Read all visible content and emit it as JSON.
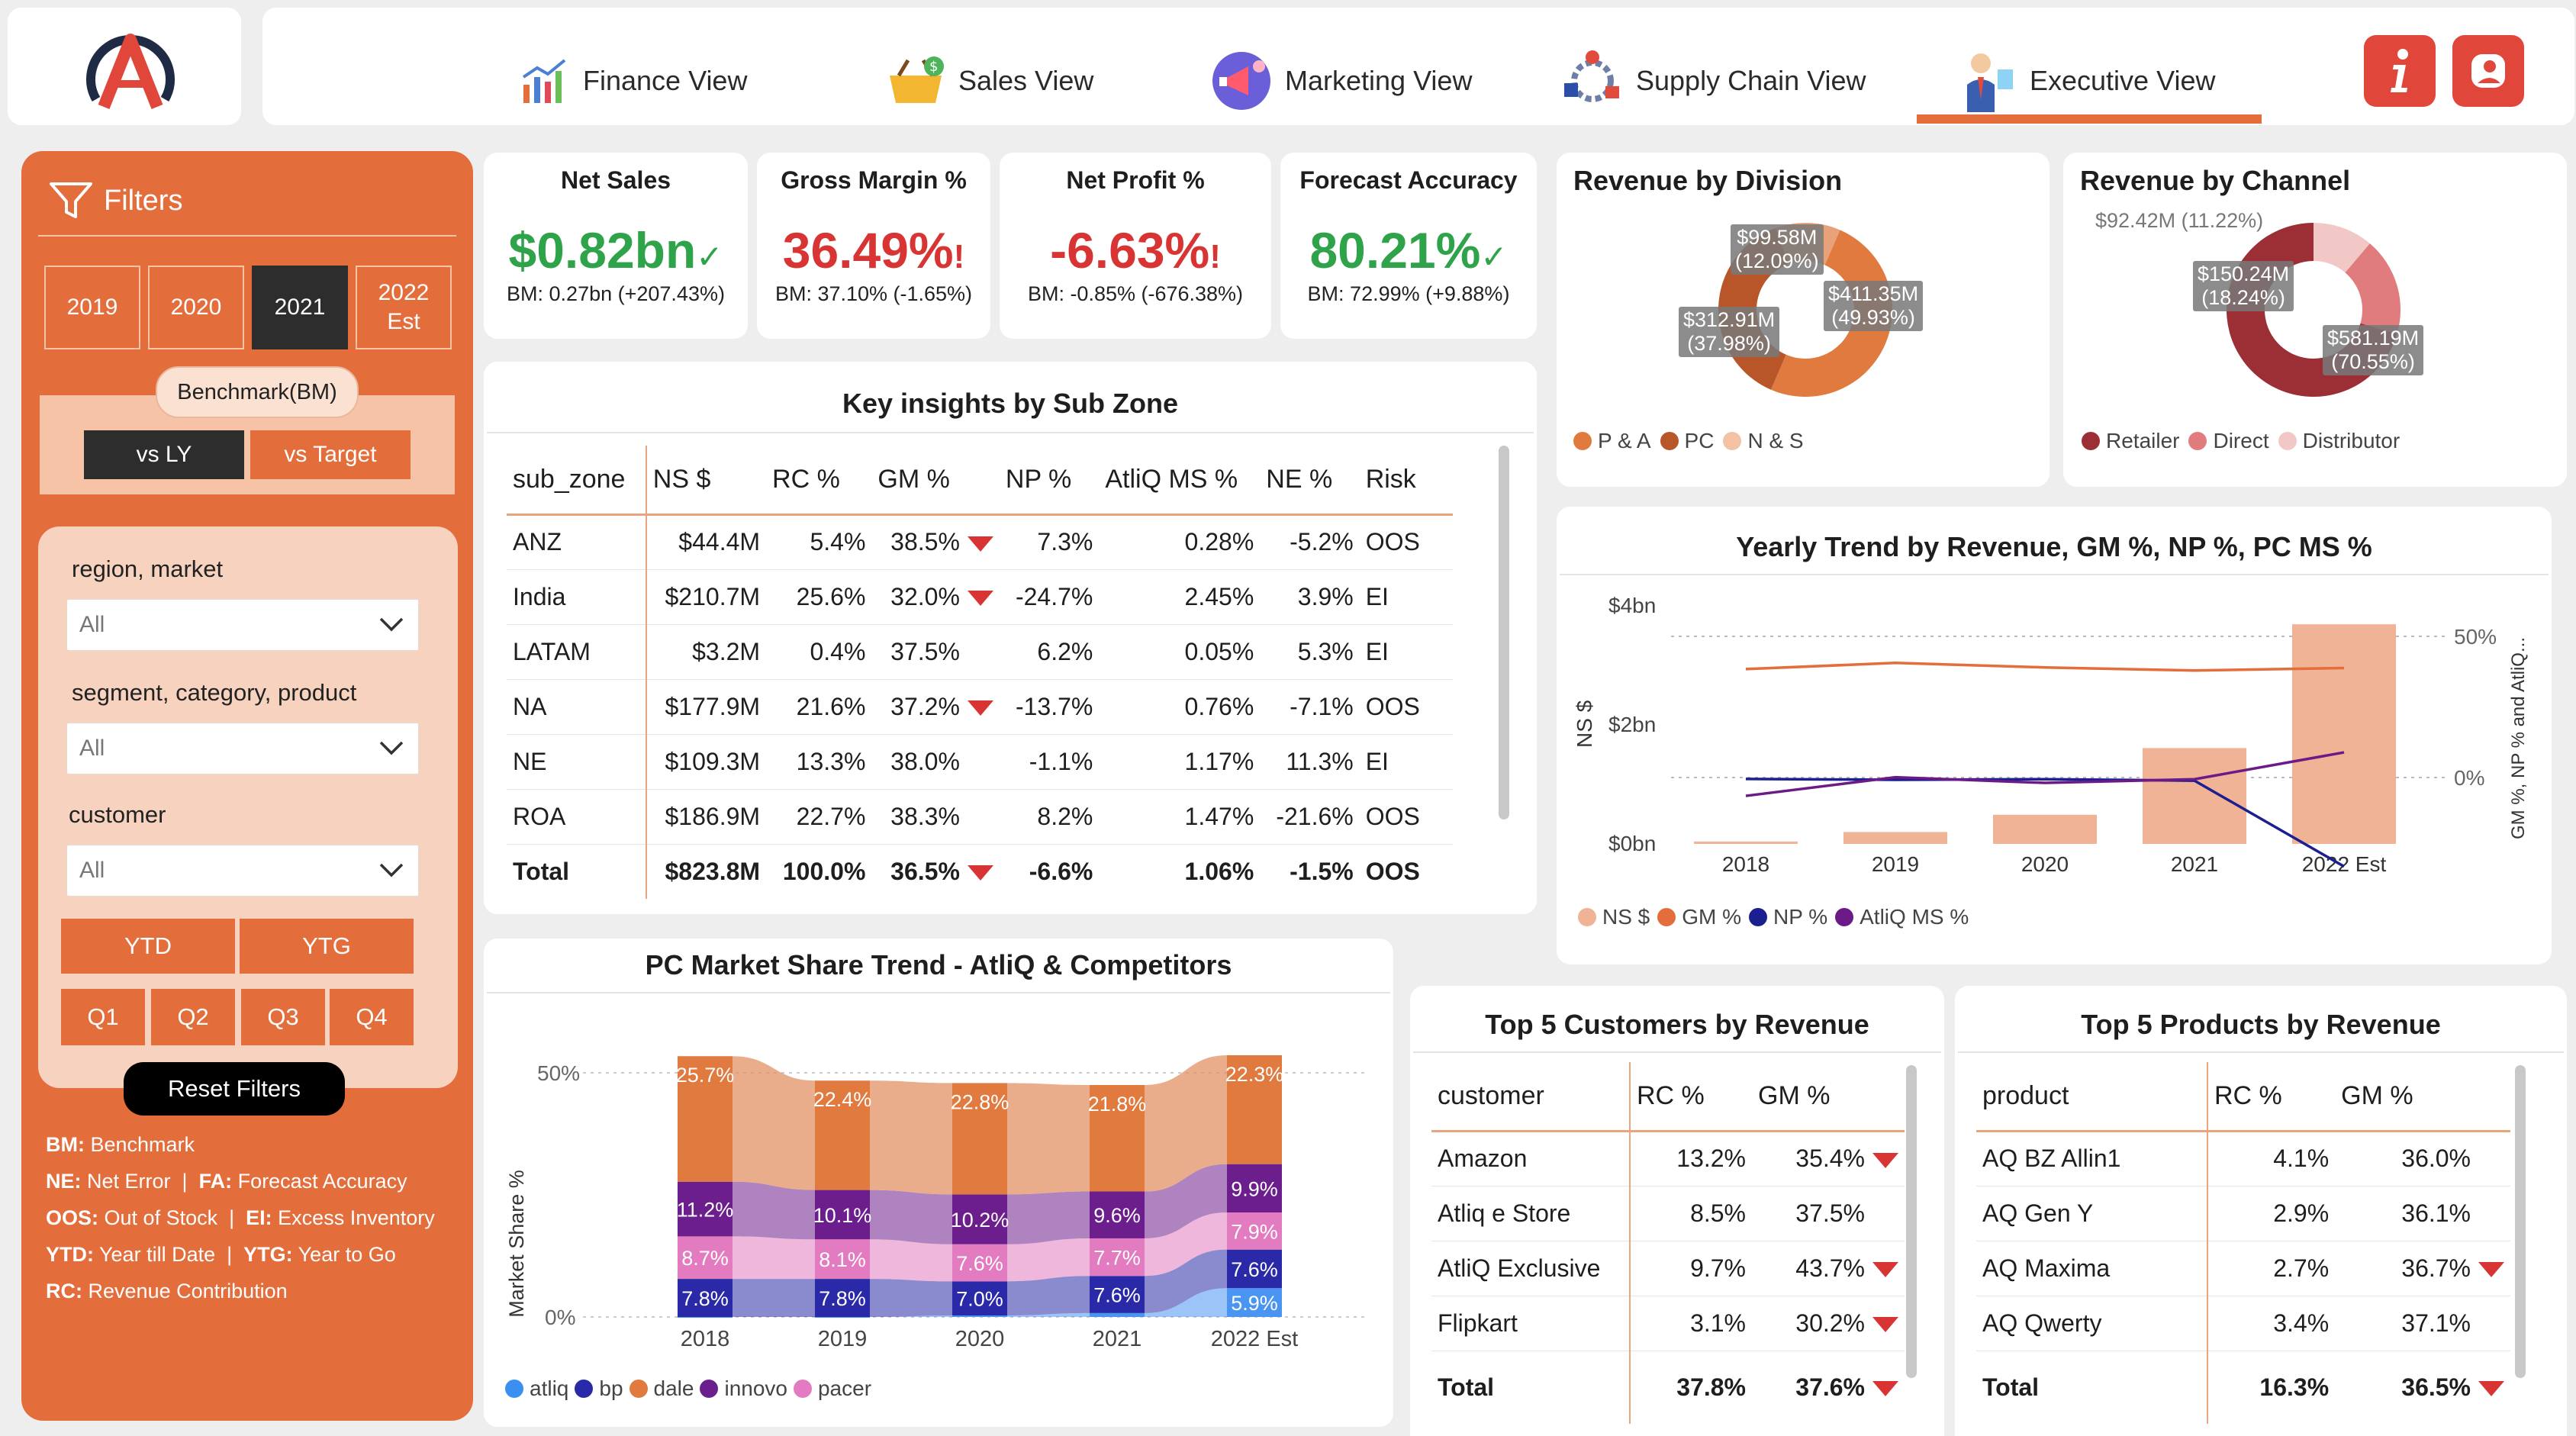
{
  "nav": {
    "tabs": [
      {
        "label": "Finance View",
        "icon": "finance-chart-icon"
      },
      {
        "label": "Sales View",
        "icon": "basket-icon"
      },
      {
        "label": "Marketing View",
        "icon": "megaphone-icon"
      },
      {
        "label": "Supply Chain View",
        "icon": "supply-chain-icon"
      },
      {
        "label": "Executive View",
        "icon": "executive-icon"
      }
    ],
    "active": "Executive View",
    "info_icon": "info-icon",
    "user_icon": "user-icon",
    "logo": "atliq-logo"
  },
  "filters": {
    "title": "Filters",
    "years": [
      "2019",
      "2020",
      "2021",
      "2022 Est"
    ],
    "selected_year": "2021",
    "benchmark_label": "Benchmark(BM)",
    "bm_options": [
      "vs LY",
      "vs Target"
    ],
    "bm_selected": "vs LY",
    "region_label": "region, market",
    "region_value": "All",
    "segment_label": "segment, category, product",
    "segment_value": "All",
    "customer_label": "customer",
    "customer_value": "All",
    "period": [
      "YTD",
      "YTG"
    ],
    "quarters": [
      "Q1",
      "Q2",
      "Q3",
      "Q4"
    ],
    "reset": "Reset Filters",
    "legend": [
      {
        "k": "BM:",
        "v": "Benchmark"
      },
      {
        "k": "NE:",
        "v": "Net Error",
        "k2": "FA:",
        "v2": "Forecast Accuracy"
      },
      {
        "k": "OOS:",
        "v": "Out of Stock",
        "k2": "EI:",
        "v2": "Excess Inventory"
      },
      {
        "k": "YTD:",
        "v": "Year till Date",
        "k2": "YTG:",
        "v2": "Year to Go"
      },
      {
        "k": "RC:",
        "v": "Revenue Contribution"
      }
    ]
  },
  "kpis": [
    {
      "title": "Net Sales",
      "value": "$0.82bn",
      "bm": "BM: 0.27bn (+207.43%)",
      "status": "good"
    },
    {
      "title": "Gross Margin %",
      "value": "36.49%",
      "bm": "BM: 37.10% (-1.65%)",
      "status": "bad"
    },
    {
      "title": "Net Profit %",
      "value": "-6.63%",
      "bm": "BM: -0.85% (-676.38%)",
      "status": "bad"
    },
    {
      "title": "Forecast Accuracy",
      "value": "80.21%",
      "bm": "BM: 72.99% (+9.88%)",
      "status": "good"
    }
  ],
  "subzone": {
    "title": "Key insights by Sub Zone",
    "headers": [
      "sub_zone",
      "NS $",
      "RC %",
      "GM %",
      "NP %",
      "AtliQ MS %",
      "NE %",
      "Risk"
    ],
    "rows": [
      {
        "c": [
          "ANZ",
          "$44.4M",
          "5.4%",
          "38.5%",
          "7.3%",
          "0.28%",
          "-5.2%",
          "OOS"
        ],
        "flag": true
      },
      {
        "c": [
          "India",
          "$210.7M",
          "25.6%",
          "32.0%",
          "-24.7%",
          "2.45%",
          "3.9%",
          "EI"
        ],
        "flag": true
      },
      {
        "c": [
          "LATAM",
          "$3.2M",
          "0.4%",
          "37.5%",
          "6.2%",
          "0.05%",
          "5.3%",
          "EI"
        ],
        "flag": false
      },
      {
        "c": [
          "NA",
          "$177.9M",
          "21.6%",
          "37.2%",
          "-13.7%",
          "0.76%",
          "-7.1%",
          "OOS"
        ],
        "flag": true
      },
      {
        "c": [
          "NE",
          "$109.3M",
          "13.3%",
          "38.0%",
          "-1.1%",
          "1.17%",
          "11.3%",
          "EI"
        ],
        "flag": false
      },
      {
        "c": [
          "ROA",
          "$186.9M",
          "22.7%",
          "38.3%",
          "8.2%",
          "1.47%",
          "-21.6%",
          "OOS"
        ],
        "flag": false
      }
    ],
    "total": {
      "c": [
        "Total",
        "$823.8M",
        "100.0%",
        "36.5%",
        "-6.6%",
        "1.06%",
        "-1.5%",
        "OOS"
      ],
      "flag": true
    }
  },
  "division": {
    "title": "Revenue by Division",
    "legend": [
      "P & A",
      "PC",
      "N & S"
    ],
    "colors": [
      "#e07a3f",
      "#b8562a",
      "#f2c2a2"
    ],
    "labels": [
      {
        "v": "$99.58M",
        "p": "(12.09%)"
      },
      {
        "v": "$411.35M",
        "p": "(49.93%)"
      },
      {
        "v": "$312.91M",
        "p": "(37.98%)"
      }
    ]
  },
  "channel": {
    "title": "Revenue by Channel",
    "legend": [
      "Retailer",
      "Direct",
      "Distributor"
    ],
    "colors": [
      "#9c2f36",
      "#e07b7e",
      "#f2c8c6"
    ],
    "outside_label": "$92.42M (11.22%)",
    "labels": [
      {
        "v": "$150.24M",
        "p": "(18.24%)"
      },
      {
        "v": "$581.19M",
        "p": "(70.55%)"
      }
    ]
  },
  "yearly": {
    "title": "Yearly Trend by Revenue, GM %, NP %, PC MS %",
    "ylabel": "NS $",
    "y2label": "GM %, NP % and AtliQ...",
    "yticks": [
      "$4bn",
      "$2bn",
      "$0bn"
    ],
    "y2ticks": [
      "50%",
      "0%"
    ],
    "legend": [
      "NS $",
      "GM %",
      "NP %",
      "AtliQ MS %"
    ],
    "legend_colors": [
      "#f0b396",
      "#e46d3c",
      "#1b1f8f",
      "#6c1a87"
    ]
  },
  "pcms": {
    "title": "PC Market Share Trend - AtliQ & Competitors",
    "ylabel": "Market Share %",
    "yticks": [
      "50%",
      "0%"
    ],
    "legend": [
      "atliq",
      "bp",
      "dale",
      "innovo",
      "pacer"
    ],
    "legend_colors": [
      "#3b8ff0",
      "#2a2aa8",
      "#e07a3f",
      "#6b1e8c",
      "#e27bc0"
    ],
    "labels": [
      [
        "25.7%",
        "11.2%",
        "8.7%",
        "7.8%"
      ],
      [
        "22.4%",
        "10.1%",
        "8.1%",
        "7.8%"
      ],
      [
        "22.8%",
        "10.2%",
        "7.6%",
        "7.0%"
      ],
      [
        "21.8%",
        "9.6%",
        "7.7%",
        "7.6%"
      ],
      [
        "22.3%",
        "9.9%",
        "7.9%",
        "7.6%",
        "5.9%"
      ]
    ]
  },
  "chart_data": [
    {
      "type": "line",
      "title": "Yearly Trend by Revenue, GM %, NP %, PC MS %",
      "categories": [
        "2018",
        "2019",
        "2020",
        "2021",
        "2022 Est"
      ],
      "ylabel": "NS $",
      "ylim": [
        0,
        4
      ],
      "series": [
        {
          "name": "NS $",
          "kind": "bar",
          "values": [
            0.04,
            0.2,
            0.49,
            1.61,
            3.69
          ]
        },
        {
          "name": "GM %",
          "values": [
            38.4,
            40.6,
            39.0,
            37.9,
            38.8
          ]
        },
        {
          "name": "NP %",
          "values": [
            -0.5,
            -0.8,
            -0.6,
            -1.1,
            -31.5
          ]
        },
        {
          "name": "AtliQ MS %",
          "values": [
            -6.5,
            0.1,
            -1.9,
            -0.6,
            8.9
          ]
        }
      ]
    },
    {
      "type": "area",
      "title": "PC Market Share Trend - AtliQ & Competitors",
      "categories": [
        "2018",
        "2019",
        "2020",
        "2021",
        "2022 Est"
      ],
      "ylabel": "Market Share %",
      "series": [
        {
          "name": "atliq",
          "values": [
            0.0,
            0.0,
            0.3,
            0.8,
            5.9
          ]
        },
        {
          "name": "bp",
          "values": [
            7.8,
            7.8,
            7.0,
            7.6,
            7.9
          ]
        },
        {
          "name": "pacer",
          "values": [
            8.7,
            8.1,
            7.6,
            7.7,
            7.6
          ]
        },
        {
          "name": "innovo",
          "values": [
            11.2,
            10.1,
            10.2,
            9.6,
            9.9
          ]
        },
        {
          "name": "dale",
          "values": [
            25.7,
            22.4,
            22.8,
            21.8,
            22.3
          ]
        }
      ]
    }
  ],
  "topcust": {
    "title": "Top 5 Customers by Revenue",
    "headers": [
      "customer",
      "RC %",
      "GM %"
    ],
    "rows": [
      {
        "c": [
          "Amazon",
          "13.2%",
          "35.4%"
        ],
        "flag": true
      },
      {
        "c": [
          "Atliq e Store",
          "8.5%",
          "37.5%"
        ],
        "flag": false
      },
      {
        "c": [
          "AtliQ Exclusive",
          "9.7%",
          "43.7%"
        ],
        "flag": true
      },
      {
        "c": [
          "Flipkart",
          "3.1%",
          "30.2%"
        ],
        "flag": true
      }
    ],
    "total": {
      "c": [
        "Total",
        "37.8%",
        "37.6%"
      ],
      "flag": true
    }
  },
  "topprod": {
    "title": "Top 5 Products by Revenue",
    "headers": [
      "product",
      "RC %",
      "GM %"
    ],
    "rows": [
      {
        "c": [
          "AQ BZ Allin1",
          "4.1%",
          "36.0%"
        ],
        "flag": false
      },
      {
        "c": [
          "AQ Gen Y",
          "2.9%",
          "36.1%"
        ],
        "flag": false
      },
      {
        "c": [
          "AQ Maxima",
          "2.7%",
          "36.7%"
        ],
        "flag": true
      },
      {
        "c": [
          "AQ Qwerty",
          "3.4%",
          "37.1%"
        ],
        "flag": false
      }
    ],
    "total": {
      "c": [
        "Total",
        "16.3%",
        "36.5%"
      ],
      "flag": true
    }
  }
}
